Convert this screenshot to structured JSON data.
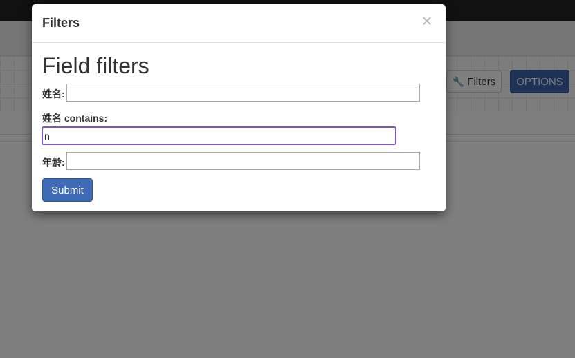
{
  "background": {
    "toolbar": {
      "filters_icon": "wrench-icon",
      "filters_icon_glyph": "🔧",
      "filters_label": "Filters",
      "options_label": "OPTIONS"
    }
  },
  "modal": {
    "title": "Filters",
    "close_glyph": "×",
    "section_heading": "Field filters",
    "fields": [
      {
        "label": "姓名:",
        "value": "",
        "placeholder": ""
      },
      {
        "label": "姓名 contains:",
        "value": "n",
        "placeholder": ""
      },
      {
        "label": "年龄:",
        "value": "",
        "placeholder": ""
      }
    ],
    "submit_label": "Submit"
  },
  "colors": {
    "primary": "#3f6ab5",
    "focus_border": "#7e57c2",
    "topbar": "#222222"
  }
}
